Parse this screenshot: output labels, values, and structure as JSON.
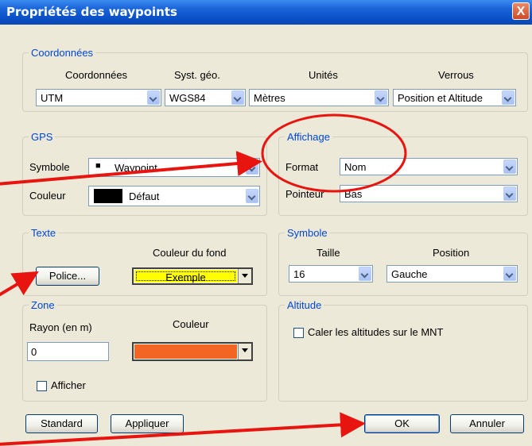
{
  "window": {
    "title": "Propriétés des waypoints",
    "close_label": "X"
  },
  "coordonnees": {
    "group_label": "Coordonnées",
    "col_coordonnees": "Coordonnées",
    "col_syst": "Syst. géo.",
    "col_unites": "Unités",
    "col_verrous": "Verrous",
    "coordonnees_value": "UTM",
    "syst_value": "WGS84",
    "unites_value": "Mètres",
    "verrous_value": "Position et Altitude"
  },
  "gps": {
    "group_label": "GPS",
    "symbole_label": "Symbole",
    "symbole_glyph": "■",
    "symbole_value": "Waypoint",
    "couleur_label": "Couleur",
    "couleur_value": "Défaut",
    "couleur_swatch": "#000000"
  },
  "affichage": {
    "group_label": "Affichage",
    "format_label": "Format",
    "format_value": "Nom",
    "pointeur_label": "Pointeur",
    "pointeur_value": "Bas"
  },
  "texte": {
    "group_label": "Texte",
    "couleur_fond_label": "Couleur du fond",
    "police_button": "Police...",
    "fond_value": "Exemple",
    "fond_color": "#ffff00"
  },
  "symbole": {
    "group_label": "Symbole",
    "taille_label": "Taille",
    "position_label": "Position",
    "taille_value": "16",
    "position_value": "Gauche"
  },
  "zone": {
    "group_label": "Zone",
    "rayon_label": "Rayon (en m)",
    "couleur_label": "Couleur",
    "rayon_value": "0",
    "couleur_color": "#f26522",
    "afficher_label": "Afficher",
    "afficher_checked": false
  },
  "altitude": {
    "group_label": "Altitude",
    "caler_label": "Caler les altitudes sur le MNT",
    "caler_checked": false
  },
  "buttons": {
    "standard": "Standard",
    "appliquer": "Appliquer",
    "ok": "OK",
    "annuler": "Annuler"
  },
  "annotation_color": "#e8140f"
}
